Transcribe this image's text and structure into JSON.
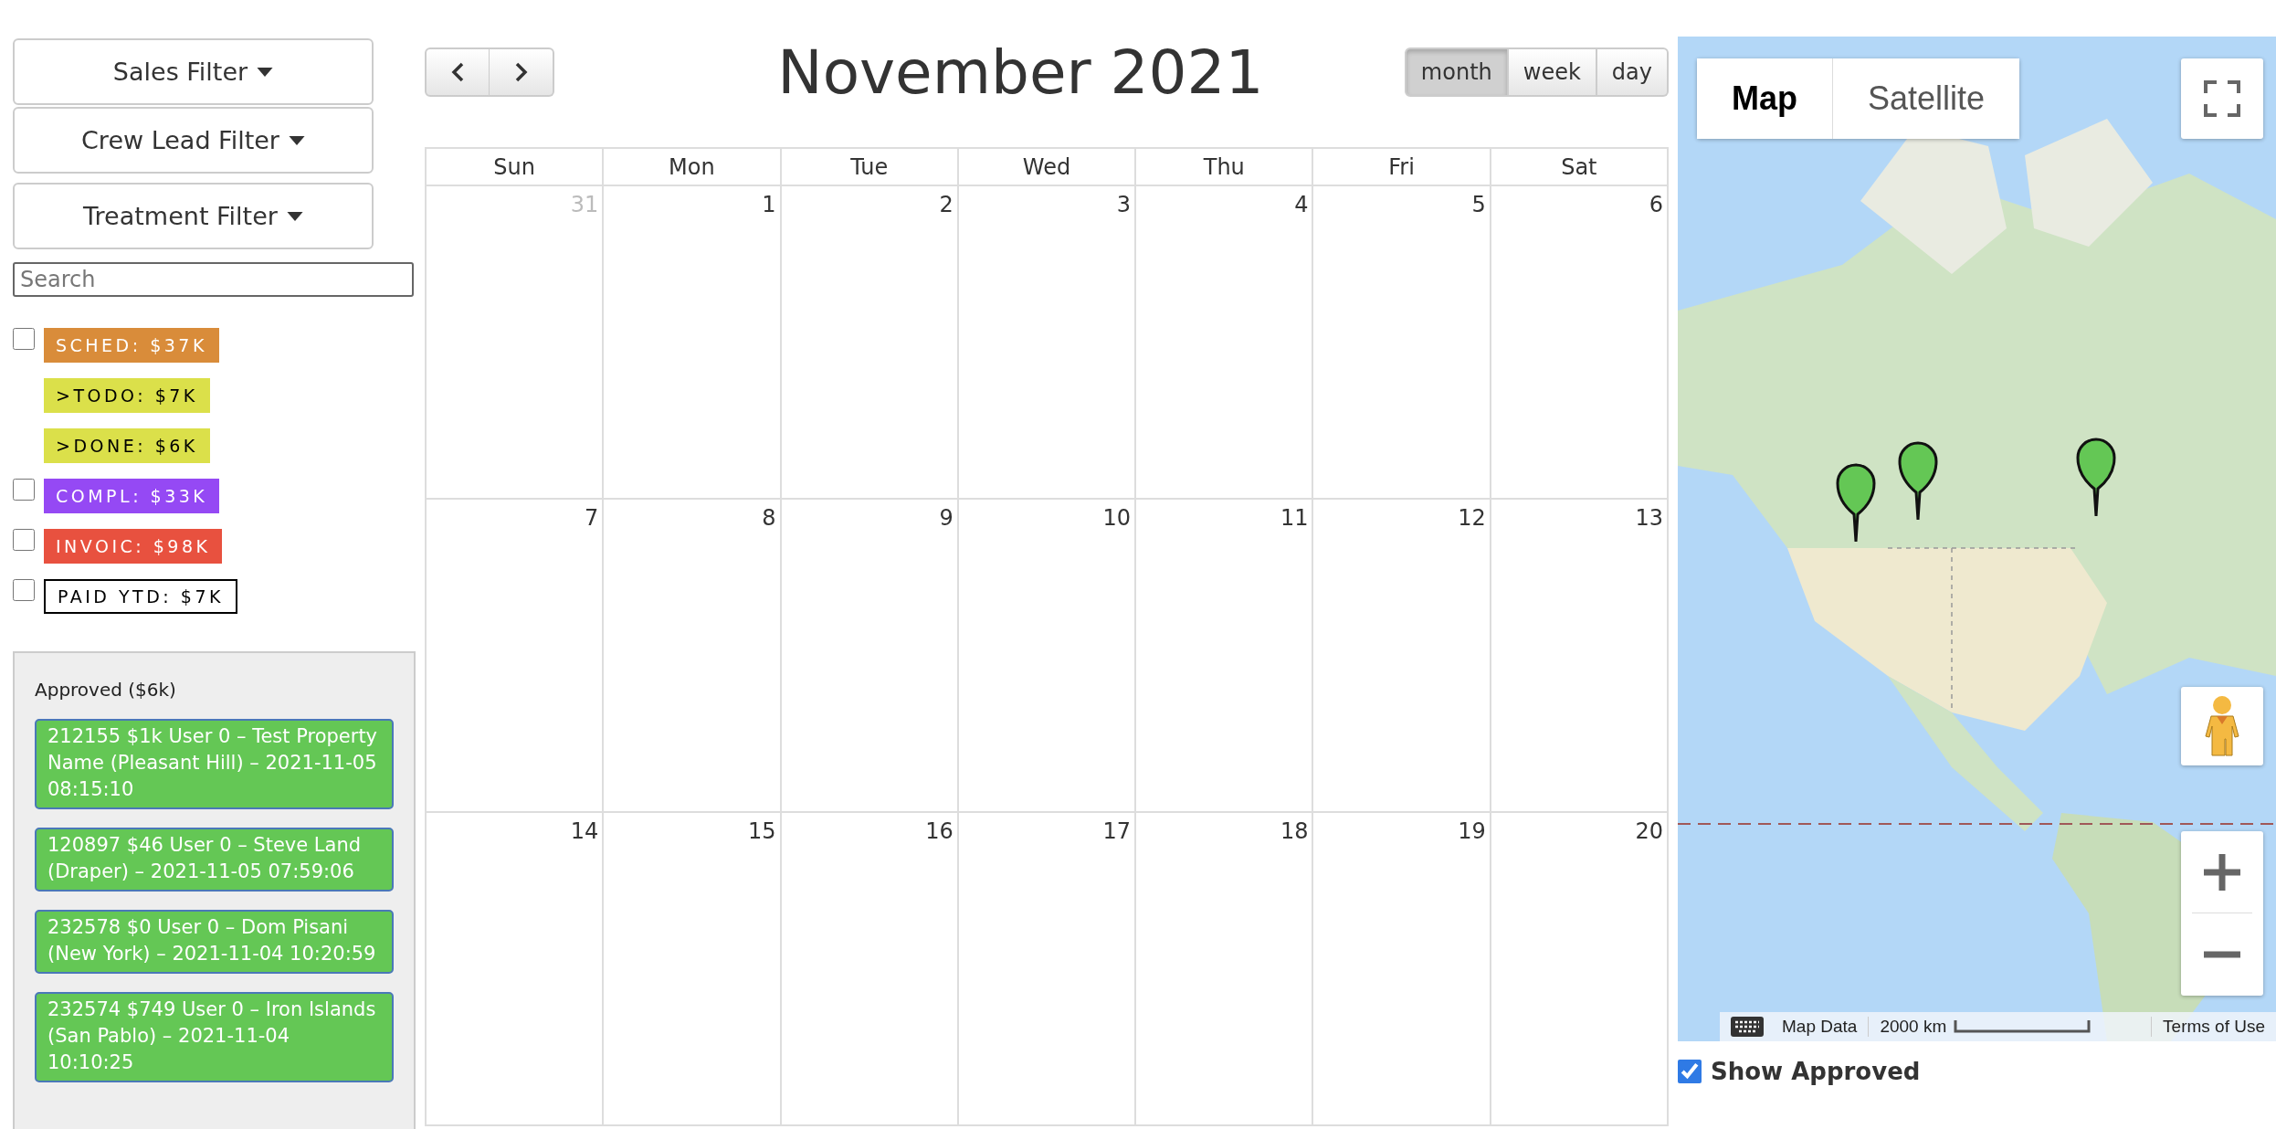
{
  "filters": [
    "Sales Filter",
    "Crew Lead Filter",
    "Treatment Filter"
  ],
  "search": {
    "placeholder": "Search"
  },
  "legend": [
    {
      "kind": "status",
      "label": "SCHED: $37K",
      "color": "#d98c3a",
      "checked": false
    },
    {
      "kind": "substatus",
      "label": ">TODO: $7K",
      "color": "#dbe04a"
    },
    {
      "kind": "substatus",
      "label": ">DONE: $6K",
      "color": "#dbe04a"
    },
    {
      "kind": "status",
      "label": "COMPL: $33K",
      "color": "#9549f4",
      "checked": false
    },
    {
      "kind": "status",
      "label": "INVOIC: $98K",
      "color": "#e8513f",
      "checked": false
    },
    {
      "kind": "total",
      "label": "PAID YTD: $7K",
      "checked": false
    }
  ],
  "approved": {
    "title": "Approved ($6k)",
    "items": [
      "212155 $1k User 0 – Test Property Name (Pleasant Hill) – 2021-11-05 08:15:10",
      "120897 $46 User 0 – Steve Land (Draper) – 2021-11-05 07:59:06",
      "232578 $0 User 0 – Dom Pisani (New York) – 2021-11-04 10:20:59",
      "232574 $749 User 0 – Iron Islands (San Pablo) – 2021-11-04 10:10:25"
    ]
  },
  "calendar": {
    "title": "November 2021",
    "views": [
      {
        "label": "month",
        "selected": true
      },
      {
        "label": "week",
        "selected": false
      },
      {
        "label": "day",
        "selected": false
      }
    ],
    "weekdays": [
      "Sun",
      "Mon",
      "Tue",
      "Wed",
      "Thu",
      "Fri",
      "Sat"
    ],
    "weeks": [
      [
        {
          "day": "31",
          "other_month": true
        },
        {
          "day": "1",
          "other_month": false
        },
        {
          "day": "2",
          "other_month": false
        },
        {
          "day": "3",
          "other_month": false
        },
        {
          "day": "4",
          "other_month": false
        },
        {
          "day": "5",
          "other_month": false
        },
        {
          "day": "6",
          "other_month": false
        }
      ],
      [
        {
          "day": "7",
          "other_month": false
        },
        {
          "day": "8",
          "other_month": false
        },
        {
          "day": "9",
          "other_month": false
        },
        {
          "day": "10",
          "other_month": false
        },
        {
          "day": "11",
          "other_month": false
        },
        {
          "day": "12",
          "other_month": false
        },
        {
          "day": "13",
          "other_month": false
        }
      ],
      [
        {
          "day": "14",
          "other_month": false
        },
        {
          "day": "15",
          "other_month": false
        },
        {
          "day": "16",
          "other_month": false
        },
        {
          "day": "17",
          "other_month": false
        },
        {
          "day": "18",
          "other_month": false
        },
        {
          "day": "19",
          "other_month": false
        },
        {
          "day": "20",
          "other_month": false
        }
      ]
    ]
  },
  "map": {
    "types": [
      {
        "label": "Map",
        "selected": true
      },
      {
        "label": "Satellite",
        "selected": false
      }
    ],
    "footer": {
      "data": "Map Data",
      "scale": "2000 km",
      "terms": "Terms of Use"
    }
  },
  "show_approved": {
    "label": "Show Approved",
    "checked": true
  }
}
